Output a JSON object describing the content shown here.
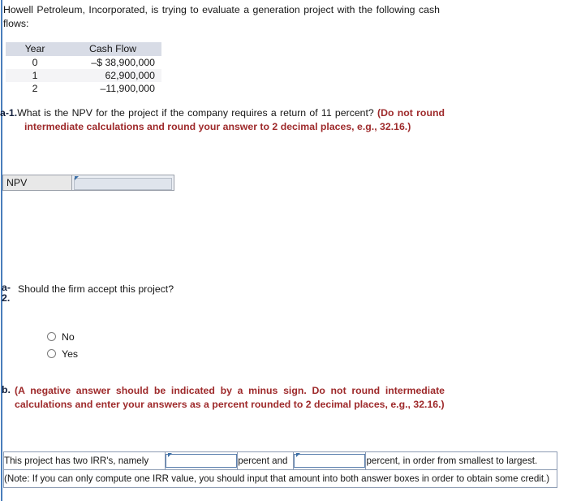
{
  "intro": {
    "paragraph": "Howell Petroleum, Incorporated, is trying to evaluate a generation project with the following cash flows:"
  },
  "cash_flow_table": {
    "headers": [
      "Year",
      "Cash Flow"
    ],
    "rows": [
      {
        "year": "0",
        "cash_flow": "–$ 38,900,000"
      },
      {
        "year": "1",
        "cash_flow": "62,900,000"
      },
      {
        "year": "2",
        "cash_flow": "–11,900,000"
      }
    ]
  },
  "question_a1": {
    "tag": "a-1.",
    "text": "What is the NPV for the project if the company requires a return of 11 percent? ",
    "emphasis": "(Do not round intermediate calculations and round your answer to 2 decimal places, e.g., 32.16.)"
  },
  "npv_answer": {
    "label": "NPV",
    "value": "",
    "placeholder": ""
  },
  "question_a2": {
    "tag_line1": "a-",
    "tag_line2": "2.",
    "text": "Should the firm accept this project?",
    "options": [
      {
        "label": "No",
        "selected": false
      },
      {
        "label": "Yes",
        "selected": false
      }
    ]
  },
  "question_b": {
    "tag": "b.",
    "emphasis": "(A negative answer should be indicated by a minus sign. Do not round intermediate calculations and enter your answers as a percent rounded to 2 decimal places, e.g., 32.16.)"
  },
  "irr_answer": {
    "lead_text": "This project has two IRR's, namely",
    "middle_text": "percent and",
    "trail_text": "percent, in order from smallest to largest.",
    "input_1": {
      "value": "",
      "placeholder": ""
    },
    "input_2": {
      "value": "",
      "placeholder": ""
    },
    "note": "(Note: If you can only compute one IRR value, you should input that amount into both answer boxes in order to obtain some credit.)"
  },
  "colors": {
    "rail": "#4a7ebb",
    "emphasis": "#9e2a2b",
    "tag": "#14213d",
    "table_header_bg": "#d8dce6",
    "stripe_bg": "#f4f4f6",
    "input_border": "#5a7fae",
    "caret_flag": "#3a6ea5"
  }
}
